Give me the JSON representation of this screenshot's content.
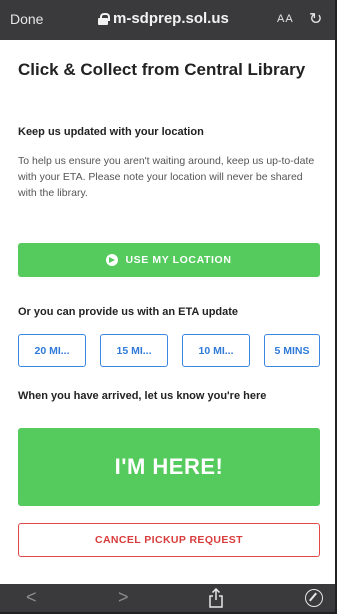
{
  "browser": {
    "done_label": "Done",
    "url": "m-sdprep.sol.us",
    "text_size_label": "AA",
    "reload_icon": "reload-icon",
    "nav": {
      "back_icon": "chevron-left-icon",
      "forward_icon": "chevron-right-icon",
      "share_icon": "share-icon",
      "compass_icon": "compass-icon"
    }
  },
  "page": {
    "title": "Click & Collect from Central Library",
    "location_heading": "Keep us updated with your location",
    "location_text": "To help us ensure you aren't waiting around, keep us up-to-date with your ETA. Please note your location will never be shared with the library.",
    "use_location_label": "USE MY LOCATION",
    "eta_heading": "Or you can provide us with an ETA update",
    "eta_options": [
      "20 MI...",
      "15 MI...",
      "10 MI...",
      "5 MINS"
    ],
    "arrived_heading": "When you have arrived, let us know you're here",
    "here_label": "I'M HERE!",
    "cancel_label": "CANCEL PICKUP REQUEST"
  },
  "colors": {
    "green": "#54cb5c",
    "blue": "#3a86e0",
    "red": "#e04848",
    "toolbar": "#3a3a3c"
  }
}
